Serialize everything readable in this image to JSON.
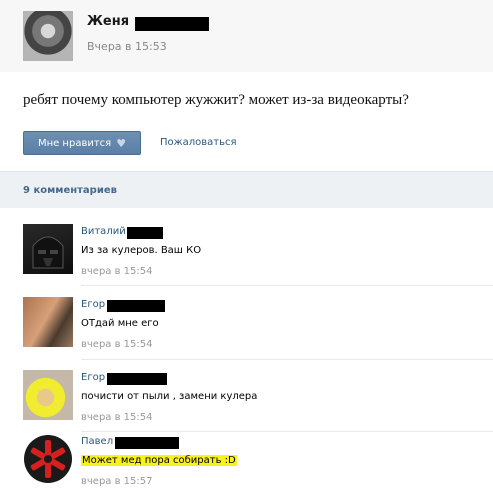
{
  "post": {
    "author_name": "Женя",
    "timestamp": "Вчера в 15:53",
    "text": "ребят почему компьютер жужжит? может из-за видеокарты?",
    "like_label": "Мне нравится",
    "report_label": "Пожаловаться"
  },
  "comments_header": {
    "count_label": "9 комментариев"
  },
  "comments": [
    {
      "name": "Виталий",
      "text": "Из за кулеров. Ваш КО",
      "time": "вчера в 15:54"
    },
    {
      "name": "Егор",
      "text": "ОТдай мне его",
      "time": "вчера в 15:54"
    },
    {
      "name": "Егор",
      "text": "почисти от пыли , замени кулера",
      "time": "вчера в 15:54"
    },
    {
      "name": "Павел",
      "text": "Может мед пора собирать :D",
      "time": "вчера в 15:57"
    }
  ],
  "colors": {
    "link": "#2b587a",
    "button": "#5b7fa6",
    "highlight": "#f7f21a"
  }
}
